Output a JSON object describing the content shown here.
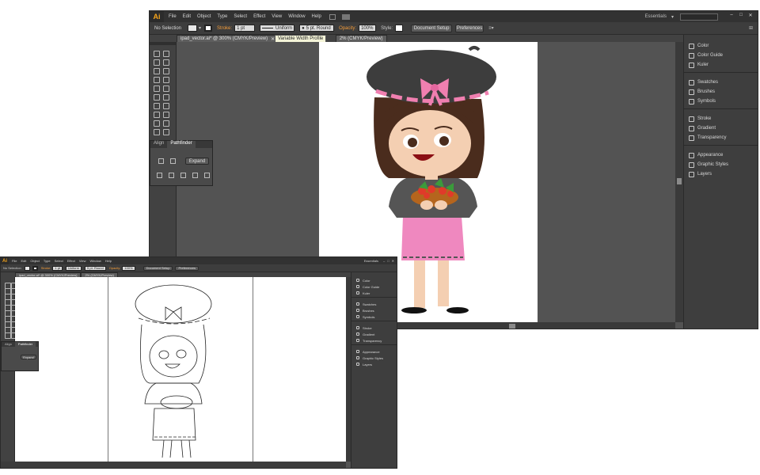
{
  "app": {
    "logo": "Ai"
  },
  "menu": [
    "File",
    "Edit",
    "Object",
    "Type",
    "Select",
    "Effect",
    "View",
    "Window",
    "Help"
  ],
  "workspace": {
    "name": "Essentials"
  },
  "control": {
    "selection": "No Selection",
    "stroke_label": "Stroke:",
    "stroke_weight": "1 pt",
    "profile": "Uniform",
    "brush": "5 pt. Round",
    "opacity_label": "Opacity:",
    "opacity_value": "100%",
    "style_label": "Style:",
    "document_setup": "Document Setup",
    "preferences": "Preferences"
  },
  "document": {
    "tab_label": "ipad_vector.ai* @ 300% (CMYK/Preview)",
    "tab2_label": "Fr",
    "tab3_label": "2% (CMYK/Preview)"
  },
  "tooltip": "Variable Width Profile",
  "align_panel": {
    "tabs": [
      "Align",
      "Pathfinder"
    ],
    "expand_label": "Expand"
  },
  "panels": [
    {
      "label": "Color",
      "icon": "color-icon"
    },
    {
      "label": "Color Guide",
      "icon": "color-guide-icon"
    },
    {
      "label": "Kuler",
      "icon": "kuler-icon"
    },
    {
      "label": "Swatches",
      "icon": "swatches-icon"
    },
    {
      "label": "Brushes",
      "icon": "brushes-icon"
    },
    {
      "label": "Symbols",
      "icon": "symbols-icon"
    },
    {
      "label": "Stroke",
      "icon": "stroke-icon"
    },
    {
      "label": "Gradient",
      "icon": "gradient-icon"
    },
    {
      "label": "Transparency",
      "icon": "transparency-icon"
    },
    {
      "label": "Appearance",
      "icon": "appearance-icon"
    },
    {
      "label": "Graphic Styles",
      "icon": "graphic-styles-icon"
    },
    {
      "label": "Layers",
      "icon": "layers-icon"
    }
  ],
  "colors": {
    "hat": "#3d3d3d",
    "ribbon": "#f07fb0",
    "skin": "#f4cfb2",
    "hair": "#4a2c1d",
    "dress": "#ef88bf",
    "shirt": "#555555",
    "bowl": "#b5651d",
    "leaves": "#3b9b3b",
    "tomato": "#e03a2a"
  }
}
